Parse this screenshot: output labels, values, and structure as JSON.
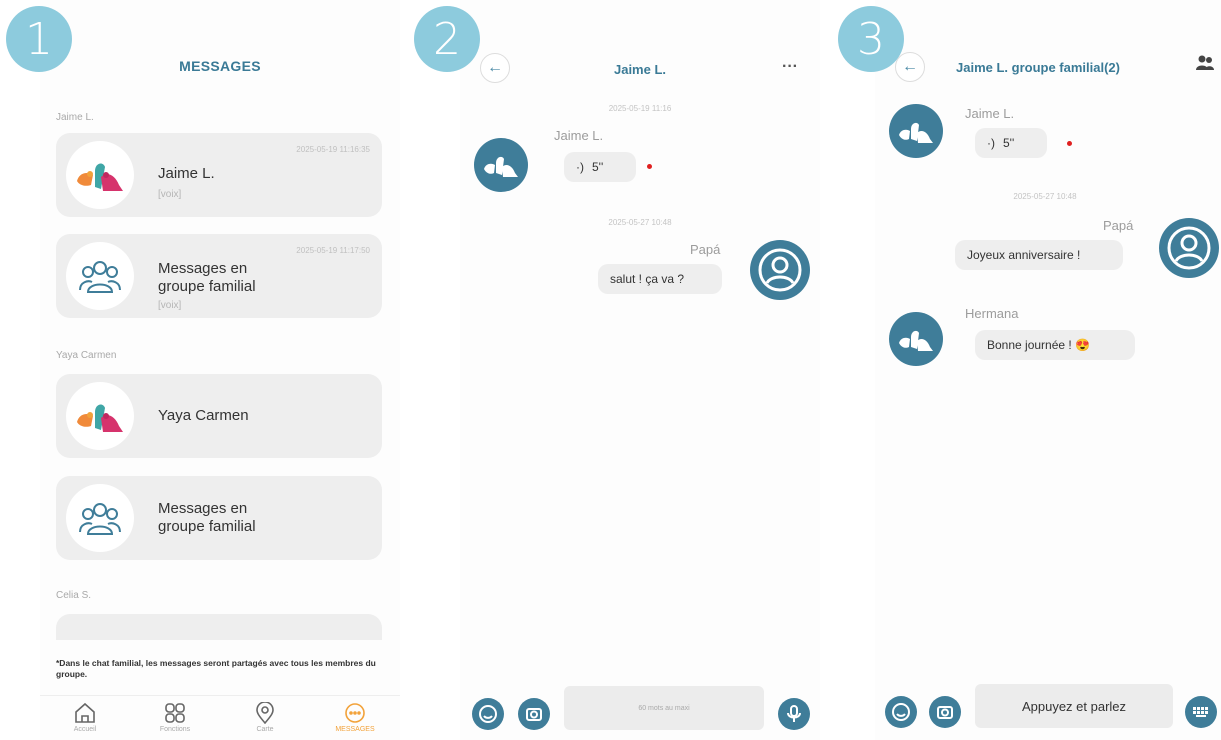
{
  "steps": [
    "1",
    "2",
    "3"
  ],
  "screen1": {
    "title": "MESSAGES",
    "sections": [
      {
        "label": "Jaime L."
      },
      {
        "label": "Yaya Carmen"
      },
      {
        "label": "Celia S."
      }
    ],
    "cards": [
      {
        "name": "Jaime L.",
        "sub": "[voix]",
        "timestamp": "2025-05-19 11:16:35",
        "avatar": "birds-logo"
      },
      {
        "name_line1": "Messages en",
        "name_line2": "groupe familial",
        "sub": "[voix]",
        "timestamp": "2025-05-19 11:17:50",
        "avatar": "group-icon"
      },
      {
        "name": "Yaya Carmen",
        "avatar": "birds-logo"
      },
      {
        "name_line1": "Messages en",
        "name_line2": "groupe familial",
        "avatar": "group-icon"
      }
    ],
    "note": "*Dans le chat familial, les messages seront partagés avec tous les membres du groupe.",
    "tabs": [
      {
        "label": "Accueil",
        "icon": "home-icon"
      },
      {
        "label": "Fonctions",
        "icon": "grid-icon"
      },
      {
        "label": "Carte",
        "icon": "location-icon"
      },
      {
        "label": "MESSAGES",
        "icon": "chat-icon",
        "active": true
      }
    ]
  },
  "screen2": {
    "title": "Jaime L.",
    "more": "···",
    "date1": "2025-05-19 11:16",
    "sender1": "Jaime L.",
    "voice1": "5''",
    "date2": "2025-05-27 10:48",
    "sender2": "Papá",
    "message2": "salut ! ça va ?",
    "input_placeholder": "60 mots au maxi"
  },
  "screen3": {
    "title": "Jaime L. groupe familial(2)",
    "sender1": "Jaime L.",
    "voice1": "5''",
    "date2": "2025-05-27 10:48",
    "sender2": "Papá",
    "message2": "Joyeux anniversaire !",
    "sender3": "Hermana",
    "message3": "Bonne journée ! 😍",
    "input_label": "Appuyez et parlez"
  },
  "colors": {
    "accent": "#3f7d99",
    "badge": "#8dcbdd",
    "active_tab": "#f2a23a",
    "unread_dot": "#e02020"
  }
}
